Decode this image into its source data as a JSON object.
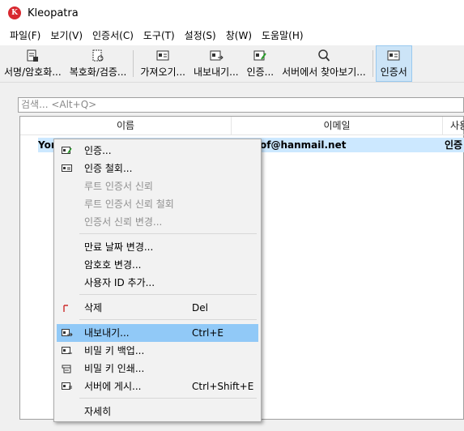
{
  "window": {
    "title": "Kleopatra",
    "logo_letter": "K"
  },
  "menubar": [
    "파일(F)",
    "보기(V)",
    "인증서(C)",
    "도구(T)",
    "설정(S)",
    "창(W)",
    "도움말(H)"
  ],
  "toolbar": {
    "sign_encrypt": "서명/암호화...",
    "decrypt_verify": "복호화/검증...",
    "import": "가져오기...",
    "export": "내보내기...",
    "certify": "인증...",
    "lookup_server": "서버에서 찾아보기...",
    "certificates": "인증서"
  },
  "search": {
    "placeholder": "검색... <Alt+Q>"
  },
  "table": {
    "columns": [
      "이름",
      "이메일",
      "사용"
    ],
    "row": {
      "name": "Yor",
      "email": "of@hanmail.net",
      "user_id": "인증"
    }
  },
  "context_menu": {
    "certify": "인증...",
    "revoke_certification": "인증 철회...",
    "trust_root": "루트 인증서 신뢰",
    "distrust_root": "루트 인증서 신뢰 철회",
    "change_trust": "인증서 신뢰 변경...",
    "change_expiry": "만료 날짜 변경...",
    "change_passphrase": "암호호 변경...",
    "add_user_id": "사용자 ID 추가...",
    "delete": "삭제",
    "delete_shortcut": "Del",
    "export": "내보내기...",
    "export_shortcut": "Ctrl+E",
    "backup_secret": "비밀 키 백업...",
    "print_secret": "비밀 키 인쇄...",
    "publish_server": "서버에 게시...",
    "publish_shortcut": "Ctrl+Shift+E",
    "details": "자세히"
  },
  "colors": {
    "selection": "#cce8ff",
    "menu_highlight": "#91c9f7",
    "logo": "#d8282f"
  }
}
